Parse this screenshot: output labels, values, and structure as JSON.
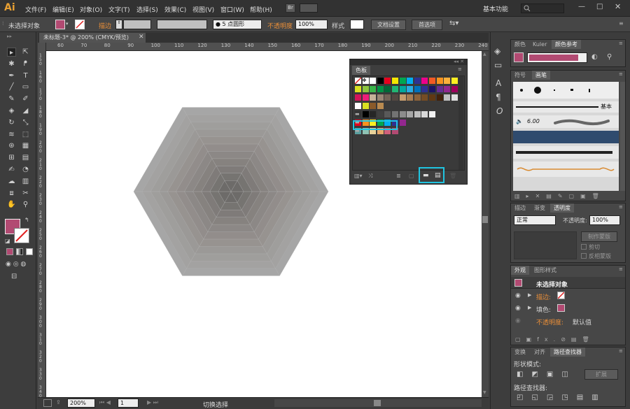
{
  "app": {
    "logo": "Ai"
  },
  "menu": [
    "文件(F)",
    "编辑(E)",
    "对象(O)",
    "文字(T)",
    "选择(S)",
    "效果(C)",
    "视图(V)",
    "窗口(W)",
    "帮助(H)"
  ],
  "bridge": "Br",
  "workspace": {
    "label": "基本功能",
    "search_placeholder": ""
  },
  "control": {
    "selection": "未选择对象",
    "stroke_label": "描边",
    "brush": "5 点圆形",
    "opacity_label": "不透明度",
    "opacity": "100%",
    "style_label": "样式",
    "doc_setup": "文档设置",
    "prefs": "首选项"
  },
  "document": {
    "tab": "未标题-3* @ 200% (CMYK/预览)"
  },
  "ruler": {
    "h": [
      "60",
      "70",
      "80",
      "90",
      "100",
      "110",
      "120",
      "130",
      "140",
      "150",
      "160",
      "170",
      "180",
      "190",
      "200",
      "210",
      "220",
      "230",
      "240"
    ],
    "v": [
      "1 5 0",
      "1 6 0",
      "1 7 0",
      "1 8 0",
      "1 9 0",
      "2 0 0",
      "2 1 0",
      "2 2 0",
      "2 3 0",
      "2 4 0",
      "2 5 0",
      "2 6 0",
      "2 7 0",
      "2 8 0",
      "2 9 0",
      "3 0 0",
      "3 1 0",
      "3 2 0",
      "3 3 0",
      "3 4 0"
    ]
  },
  "status": {
    "zoom": "200%",
    "page": "1",
    "tool": "切换选择"
  },
  "swatch_panel": {
    "title": "色板"
  },
  "color_panel": {
    "tabs": [
      "颜色",
      "Kuler",
      "颜色参考"
    ]
  },
  "brush_panel": {
    "tabs": [
      "符号",
      "画笔"
    ],
    "basic": "基本",
    "size": "6.00"
  },
  "transparency_panel": {
    "tabs": [
      "描边",
      "渐变",
      "透明度"
    ],
    "mode": "正常",
    "opacity_label": "不透明度:",
    "opacity": "100%",
    "mask_btn": "制作蒙版",
    "clip": "剪切",
    "invert": "反相蒙版"
  },
  "appearance_panel": {
    "tabs": [
      "外观",
      "图形样式"
    ],
    "title": "未选择对象",
    "stroke": "描边:",
    "fill": "填色:",
    "opacity": "不透明度:",
    "opacity_value": "默认值"
  },
  "pathfinder_panel": {
    "tabs": [
      "变换",
      "对齐",
      "路径查找器"
    ],
    "shape_modes": "形状模式:",
    "expand": "扩展",
    "pathfinders": "路径查找器:"
  },
  "colors": {
    "fill": "#b24a72",
    "highlight": "#20c4e0"
  }
}
